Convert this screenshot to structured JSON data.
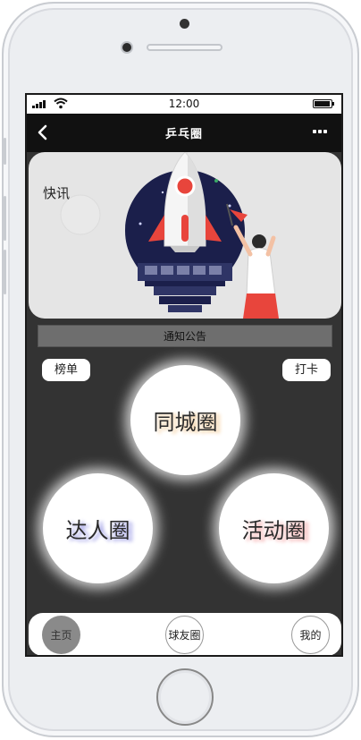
{
  "status_bar": {
    "time": "12:00"
  },
  "nav": {
    "title": "乒乓圈"
  },
  "news": {
    "label": "快讯"
  },
  "notice": {
    "label": "通知公告"
  },
  "buttons": {
    "rank": "榜单",
    "checkin": "打卡"
  },
  "circles": {
    "city": "同城圈",
    "expert": "达人圈",
    "event": "活动圈"
  },
  "tabs": {
    "home": "主页",
    "friends": "球友圈",
    "me": "我的"
  },
  "colors": {
    "screen_bg": "#333333",
    "nav_bg": "#111111",
    "card_bg": "#e5e5e5",
    "rocket_accent": "#e8453c",
    "bulb_navy": "#1b1f4b"
  }
}
